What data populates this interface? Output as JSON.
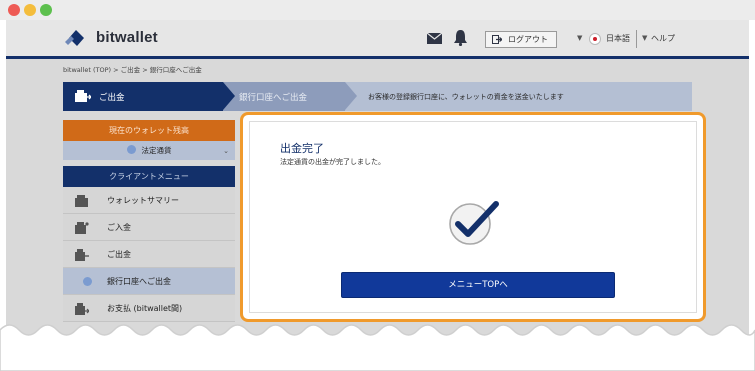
{
  "header": {
    "logo_text": "bitwallet",
    "logout_label": "ログアウト",
    "language": "日本語",
    "help_label": "ヘルプ"
  },
  "breadcrumb": {
    "text": "bitwallet (TOP)  >  ご出金  >  銀行口座へご出金"
  },
  "steps": {
    "step1": "ご出金",
    "step2": "銀行口座へご出金",
    "step3": "お客様の登録銀行口座に、ウォレットの資金を送金いたします"
  },
  "sidebar": {
    "balance_title": "現在のウォレット残高",
    "currency_select": "法定通貨",
    "menu_title": "クライアントメニュー",
    "items": [
      {
        "label": "ウォレットサマリー",
        "icon": "wallet-icon"
      },
      {
        "label": "ご入金",
        "icon": "deposit-icon"
      },
      {
        "label": "ご出金",
        "icon": "withdraw-icon"
      },
      {
        "label": "銀行口座へご出金",
        "icon": "coin-icon"
      },
      {
        "label": "お支払 (bitwallet間)",
        "icon": "payment-icon"
      }
    ]
  },
  "modal": {
    "title": "出金完了",
    "message": "法定通貨の出金が完了しました。",
    "button_label": "メニューTOPへ"
  },
  "colors": {
    "brand_navy": "#13306a",
    "accent_orange": "#f09a2c",
    "button_blue": "#11399a"
  }
}
